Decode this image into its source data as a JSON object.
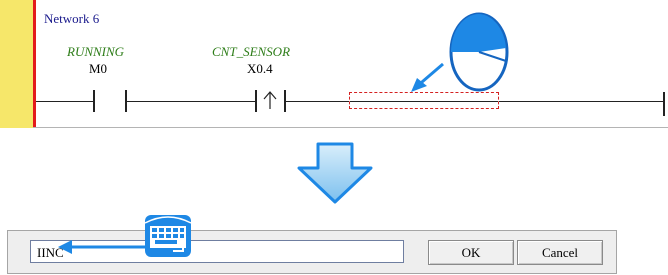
{
  "network": {
    "title": "Network 6",
    "contacts": [
      {
        "label": "RUNNING",
        "device": "M0"
      },
      {
        "label": "CNT_SENSOR",
        "device": "X0.4"
      }
    ]
  },
  "dialog": {
    "input_value": "IINC",
    "ok_label": "OK",
    "cancel_label": "Cancel"
  },
  "icons": {
    "mouse": "mouse-click-icon",
    "keyboard": "keyboard-icon",
    "arrow": "down-arrow-icon"
  },
  "colors": {
    "power_rail": "#e31b1b",
    "left_bar": "#f6e76a",
    "contact_label": "#2e7d19",
    "network_title": "#1a1a8c",
    "accent_blue": "#1e88e5"
  }
}
